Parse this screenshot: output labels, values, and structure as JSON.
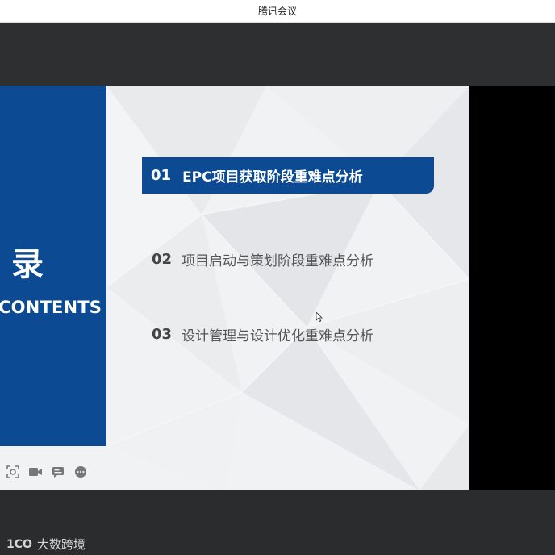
{
  "window": {
    "title": "腾讯会议"
  },
  "slide": {
    "panel_char": "录",
    "panel_title": "CONTENTS",
    "items": [
      {
        "num": "01",
        "label": "EPC项目获取阶段重难点分析",
        "active": true
      },
      {
        "num": "02",
        "label": "项目启动与策划阶段重难点分析",
        "active": false
      },
      {
        "num": "03",
        "label": "设计管理与设计优化重难点分析",
        "active": false
      }
    ],
    "toolbar_icons": [
      "screen-capture-icon",
      "video-camera-icon",
      "subtitle-icon",
      "more-icon"
    ]
  },
  "colors": {
    "accent_blue": "#0c4a94",
    "meeting_dark": "#2b2c2e"
  },
  "watermark": {
    "logo": "1CO",
    "text": "大数跨境"
  }
}
